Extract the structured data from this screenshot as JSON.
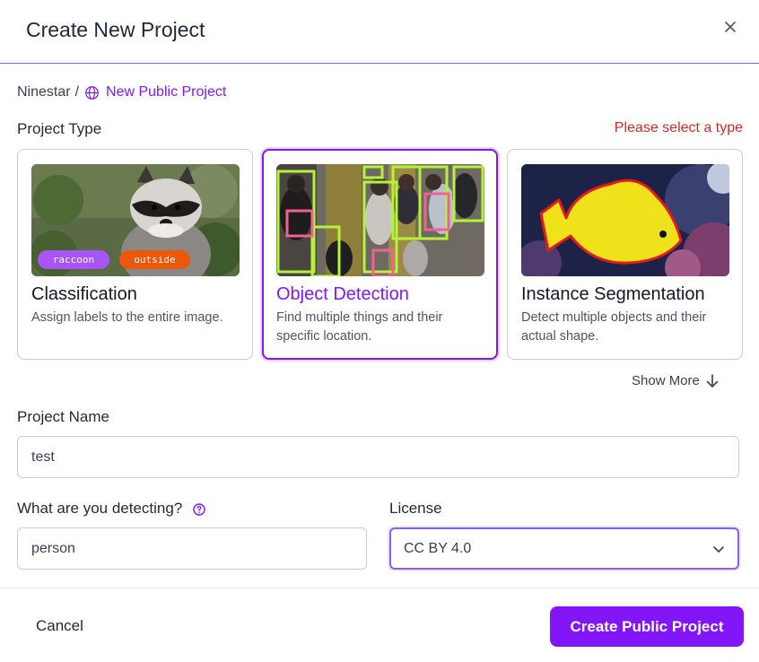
{
  "dialog": {
    "title": "Create New Project"
  },
  "breadcrumb": {
    "workspace": "Ninestar",
    "separator": "/",
    "current": "New Public Project"
  },
  "project_type": {
    "label": "Project Type",
    "error": "Please select a type",
    "cards": [
      {
        "title": "Classification",
        "description": "Assign labels to the entire image.",
        "tags": [
          "raccoon",
          "outside"
        ],
        "selected": false
      },
      {
        "title": "Object Detection",
        "description": "Find multiple things and their specific location.",
        "selected": true
      },
      {
        "title": "Instance Segmentation",
        "description": "Detect multiple objects and their actual shape.",
        "selected": false
      }
    ],
    "show_more": "Show More"
  },
  "project_name": {
    "label": "Project Name",
    "value": "test"
  },
  "detecting": {
    "label": "What are you detecting?",
    "value": "person"
  },
  "license": {
    "label": "License",
    "value": "CC BY 4.0"
  },
  "footer": {
    "cancel": "Cancel",
    "create": "Create Public Project"
  },
  "colors": {
    "accent": "#8315f9",
    "error": "#dc2626",
    "tag_purple": "#a855f7",
    "tag_orange": "#ea580c"
  }
}
